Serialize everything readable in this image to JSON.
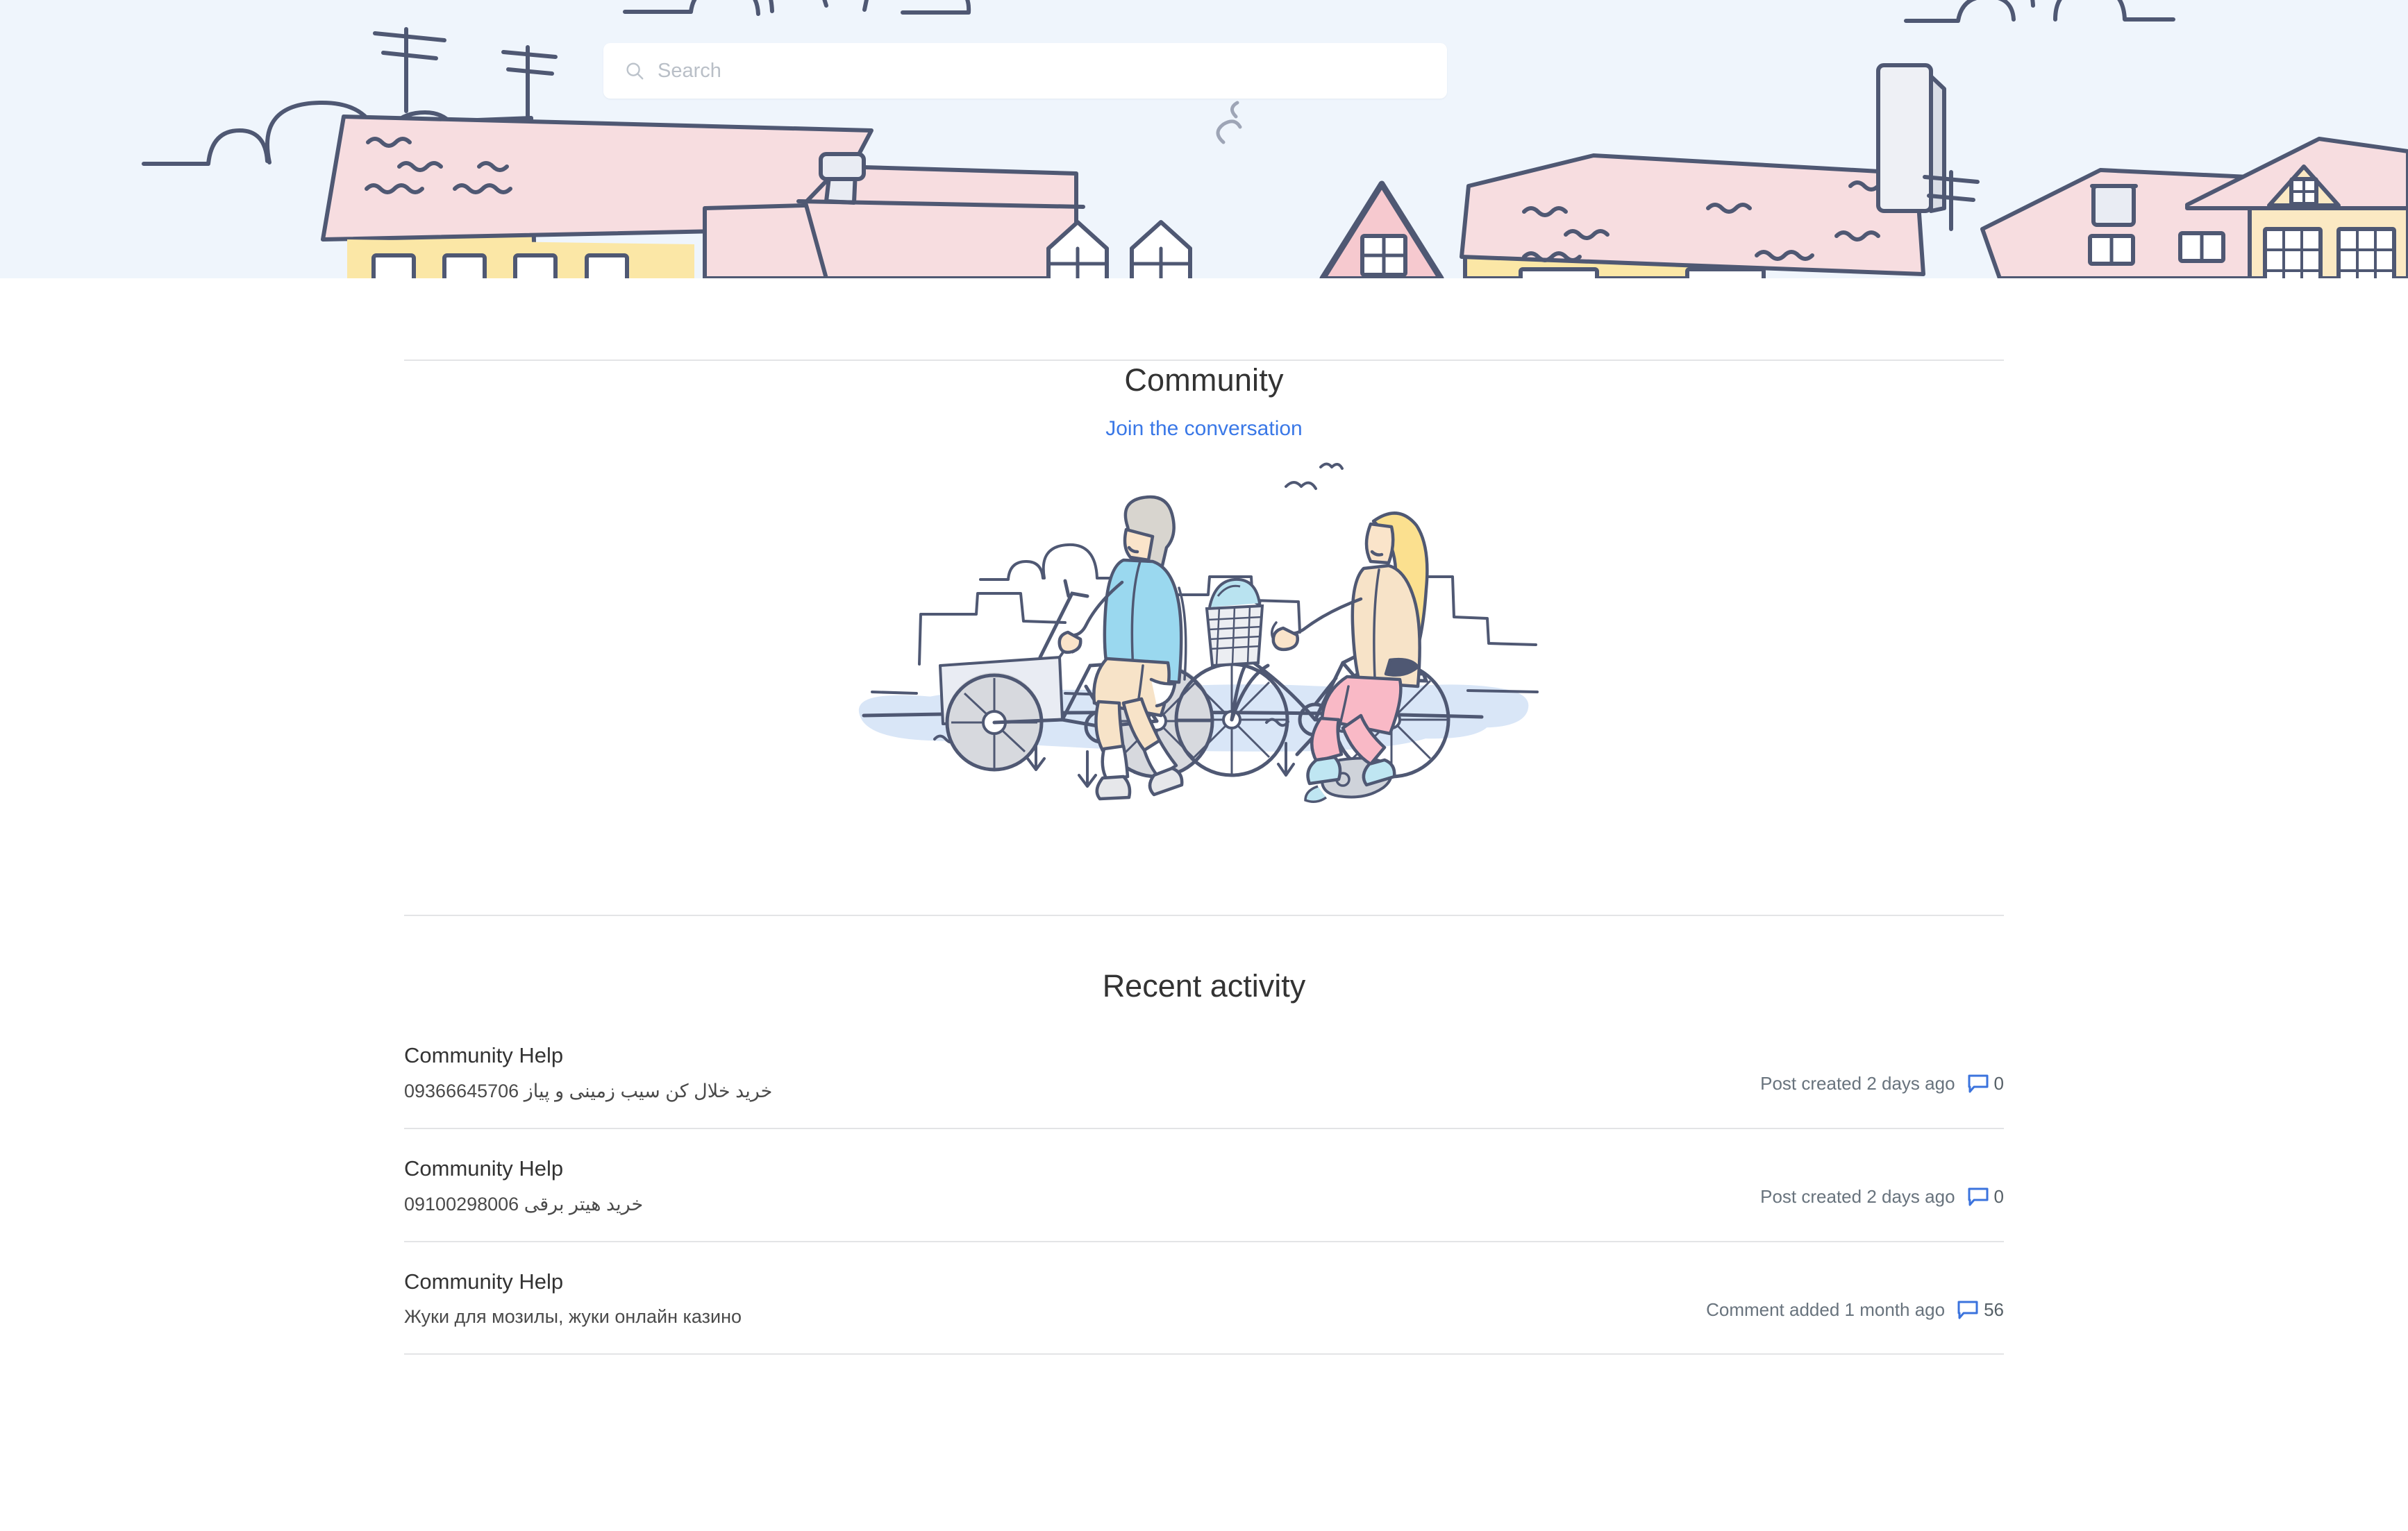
{
  "search": {
    "placeholder": "Search",
    "value": "",
    "icon": "search-icon"
  },
  "hero": {
    "icon": "town-illustration",
    "background_color": "#eff5fc",
    "roof_color": "#f7dde0",
    "wall_color": "#fbe7a6",
    "outline_color": "#4f5873"
  },
  "community": {
    "title": "Community",
    "link_label": "Join the conversation",
    "illustration": "cyclists-illustration"
  },
  "recent": {
    "title": "Recent activity",
    "items": [
      {
        "source": "Community Help",
        "text": "خرید خلال کن سیب زمینی و پیاز 09366645706",
        "rtl": true,
        "meta": "Post created 2 days ago",
        "comment_icon": "comment-bubble-icon",
        "comment_count": "0"
      },
      {
        "source": "Community Help",
        "text": "خرید هیتر برقی 09100298006",
        "rtl": true,
        "meta": "Post created 2 days ago",
        "comment_icon": "comment-bubble-icon",
        "comment_count": "0"
      },
      {
        "source": "Community Help",
        "text": "Жуки для мозилы, жуки онлайн казино",
        "rtl": false,
        "meta": "Comment added 1 month ago",
        "comment_icon": "comment-bubble-icon",
        "comment_count": "56"
      }
    ]
  },
  "colors": {
    "link_blue": "#3a78e7",
    "icon_blue": "#3b73dd",
    "text_dark": "#333333",
    "text_muted": "#68737d",
    "divider": "#e3e4e6"
  }
}
